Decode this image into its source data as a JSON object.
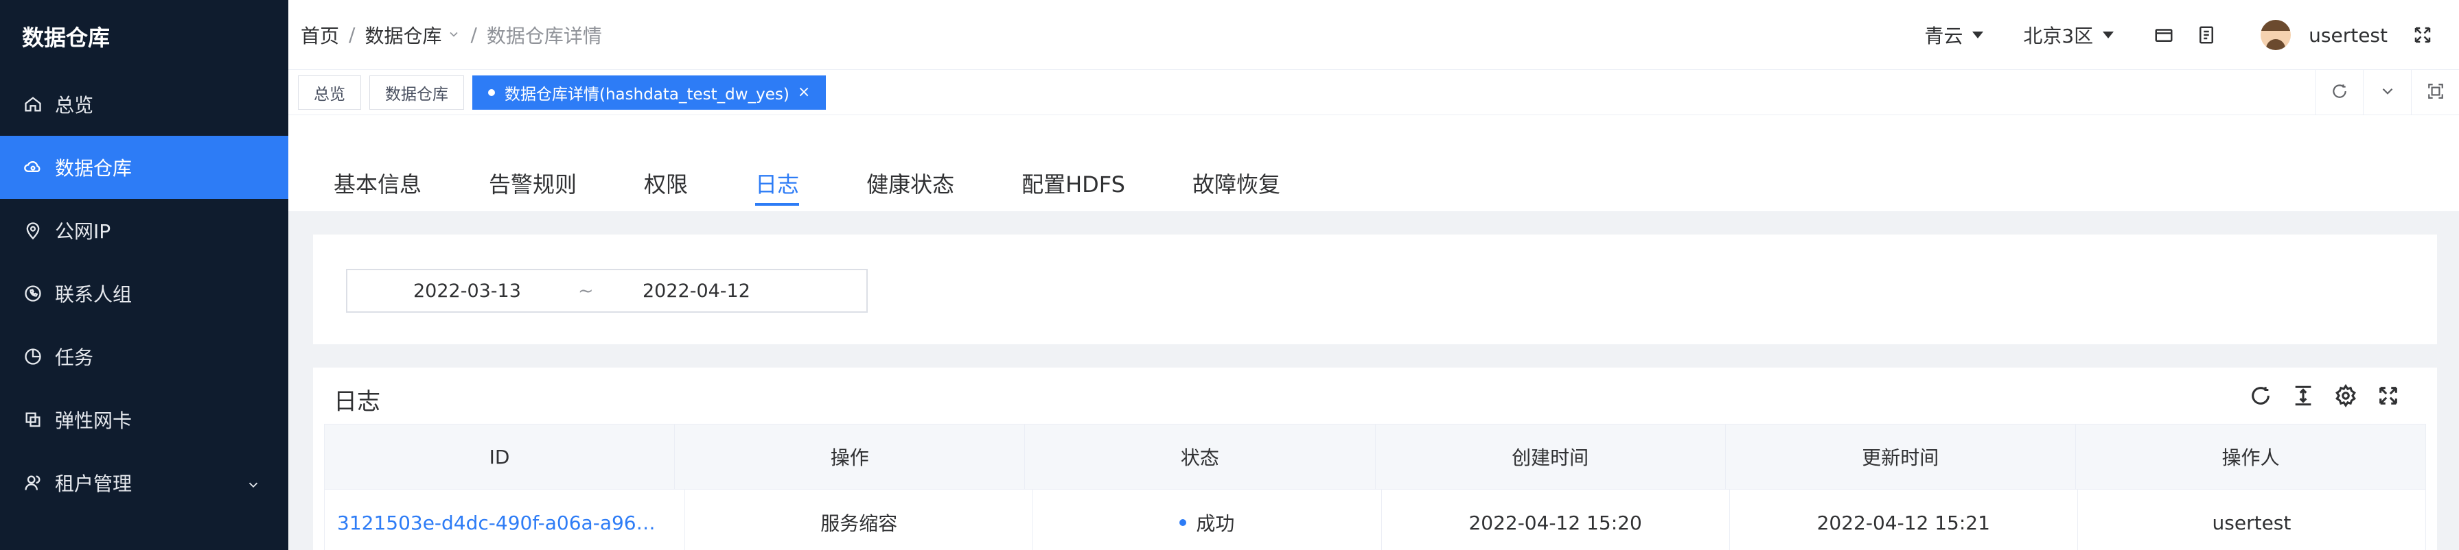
{
  "app": {
    "brand": "数据仓库"
  },
  "sidebar": {
    "items": [
      {
        "label": "总览",
        "icon": "home-icon"
      },
      {
        "label": "数据仓库",
        "icon": "cloud-database-icon",
        "active": true
      },
      {
        "label": "公网IP",
        "icon": "location-pin-icon"
      },
      {
        "label": "联系人组",
        "icon": "phone-chat-icon"
      },
      {
        "label": "任务",
        "icon": "pie-chart-icon"
      },
      {
        "label": "弹性网卡",
        "icon": "copy-icon"
      },
      {
        "label": "租户管理",
        "icon": "user-group-icon"
      }
    ]
  },
  "header": {
    "breadcrumb": {
      "home": "首页",
      "level1": "数据仓库",
      "current": "数据仓库详情",
      "sep": "/"
    },
    "region": "青云",
    "zone": "北京3区",
    "username": "usertest"
  },
  "tags": {
    "items": [
      {
        "label": "总览"
      },
      {
        "label": "数据仓库"
      },
      {
        "label": "数据仓库详情(hashdata_test_dw_yes)",
        "active": true,
        "close": "×"
      }
    ]
  },
  "tabs": [
    {
      "label": "基本信息"
    },
    {
      "label": "告警规则"
    },
    {
      "label": "权限"
    },
    {
      "label": "日志",
      "active": true
    },
    {
      "label": "健康状态"
    },
    {
      "label": "配置HDFS"
    },
    {
      "label": "故障恢复"
    }
  ],
  "filter": {
    "start": "2022-03-13",
    "sep": "~",
    "end": "2022-04-12"
  },
  "log": {
    "title": "日志",
    "columns": [
      "ID",
      "操作",
      "状态",
      "创建时间",
      "更新时间",
      "操作人"
    ],
    "rows": [
      {
        "id": "3121503e-d4dc-490f-a06a-a963...",
        "action": "服务缩容",
        "status": "成功",
        "created": "2022-04-12 15:20",
        "updated": "2022-04-12 15:21",
        "operator": "usertest"
      }
    ]
  },
  "colors": {
    "accent": "#2d7cf6",
    "sidebar_bg": "#0f1c2e"
  }
}
